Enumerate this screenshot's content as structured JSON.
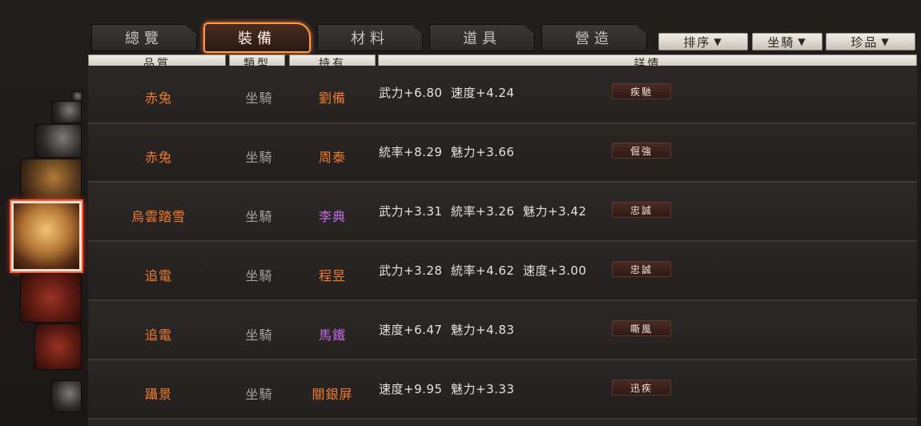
{
  "tabs": [
    {
      "label": "總覽",
      "active": false
    },
    {
      "label": "裝備",
      "active": true
    },
    {
      "label": "材料",
      "active": false
    },
    {
      "label": "道具",
      "active": false
    },
    {
      "label": "營造",
      "active": false
    }
  ],
  "filters": [
    {
      "label": "排序",
      "arrow": "▼"
    },
    {
      "label": "坐騎",
      "arrow": "▼"
    },
    {
      "label": "珍品",
      "arrow": "▼"
    }
  ],
  "columns": [
    "品質",
    "類型",
    "持有",
    "詳情"
  ],
  "rows": [
    {
      "quality": "赤兔",
      "type": "坐騎",
      "owner": "劉備",
      "owner_color": "orange",
      "details": "武力+6.80  速度+4.24",
      "tag": "疾馳"
    },
    {
      "quality": "赤兔",
      "type": "坐騎",
      "owner": "周泰",
      "owner_color": "orange",
      "details": "統率+8.29  魅力+3.66",
      "tag": "倔強"
    },
    {
      "quality": "烏雲踏雪",
      "type": "坐騎",
      "owner": "李典",
      "owner_color": "purple",
      "details": "武力+3.31  統率+3.26  魅力+3.42",
      "tag": "忠誠"
    },
    {
      "quality": "追電",
      "type": "坐騎",
      "owner": "程昱",
      "owner_color": "orange",
      "details": "武力+3.28  統率+4.62  速度+3.00",
      "tag": "忠誠"
    },
    {
      "quality": "追電",
      "type": "坐騎",
      "owner": "馬鐵",
      "owner_color": "purple",
      "details": "速度+6.47  魅力+4.83",
      "tag": "嘶風"
    },
    {
      "quality": "躡景",
      "type": "坐騎",
      "owner": "關銀屏",
      "owner_color": "orange",
      "details": "速度+9.95  魅力+3.33",
      "tag": "迅疾"
    }
  ],
  "colors": {
    "quality_orange": "#f07c2e",
    "owner_purple": "#c46de0",
    "active_tab_glow": "#ff9a4a"
  },
  "carousel": {
    "icons": [
      "horse-icon",
      "horse-icon",
      "horse-icon",
      "horse-icon",
      "horse-icon",
      "horse-icon",
      "horse-icon"
    ],
    "selected_index": 3
  }
}
